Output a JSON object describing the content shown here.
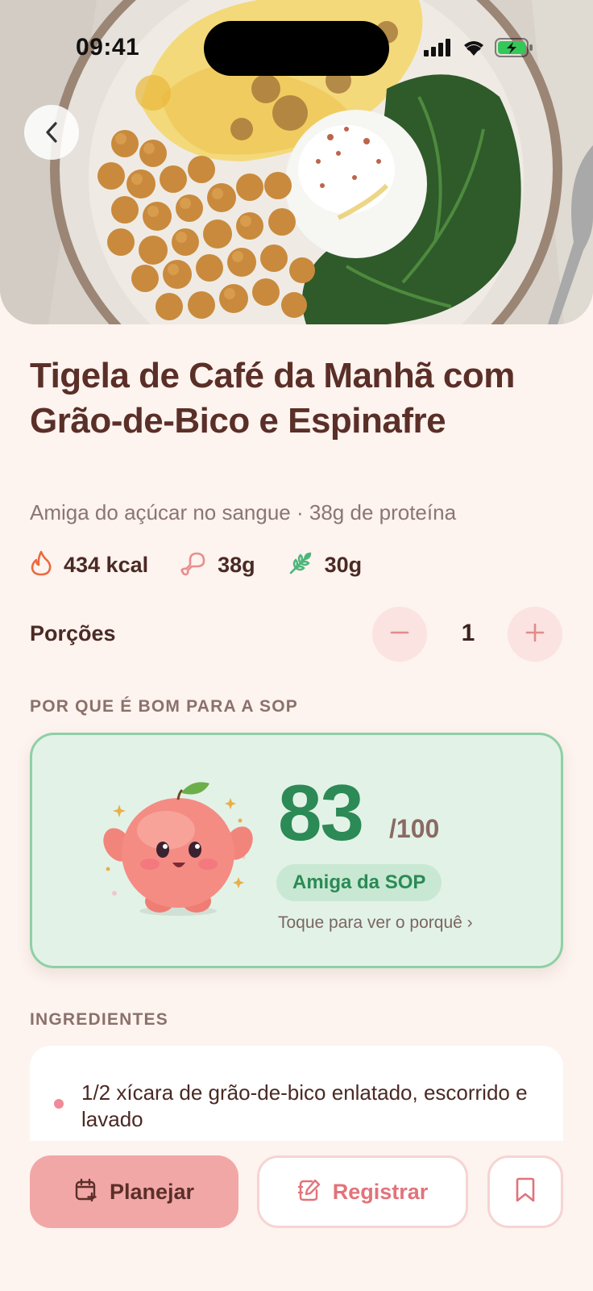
{
  "status_bar": {
    "time": "09:41"
  },
  "recipe": {
    "title": "Tigela de Café da Manhã com Grão-de-Bico e Espinafre",
    "subtitle": "Amiga do açúcar no sangue · 38g de proteína",
    "macros": [
      {
        "icon": "flame-icon",
        "value": "434 kcal"
      },
      {
        "icon": "drumstick-icon",
        "value": "38g"
      },
      {
        "icon": "wheat-icon",
        "value": "30g"
      }
    ]
  },
  "servings": {
    "label": "Porções",
    "value": "1"
  },
  "sop_section": {
    "heading": "POR QUE É BOM PARA A SOP",
    "score": "83",
    "score_max": "/100",
    "badge": "Amiga da SOP",
    "hint": "Toque para ver o porquê ›"
  },
  "ingredients": {
    "heading": "INGREDIENTES",
    "items": [
      "1/2 xícara de grão-de-bico enlatado, escorrido e lavado"
    ]
  },
  "actions": {
    "plan_label": "Planejar",
    "log_label": "Registrar"
  },
  "colors": {
    "background": "#FDF3EF",
    "title": "#5A2F27",
    "score_green": "#2B8A55",
    "card_green": "#E3F2E7",
    "accent_pink": "#F2A7A7",
    "log_red": "#E2737A"
  }
}
